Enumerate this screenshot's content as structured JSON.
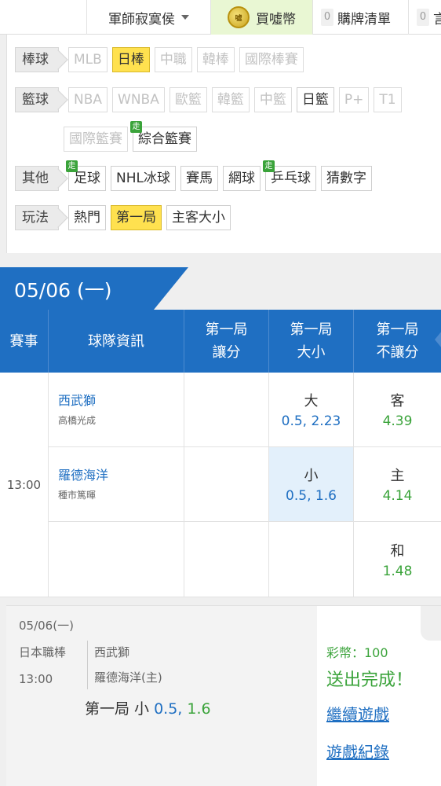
{
  "topbar": {
    "user": "軍師寂寞侯",
    "buy": "買噓幣",
    "coin_icon_text": "噓",
    "cart_count": "0",
    "cart_label": "購牌清單",
    "more_count": "0",
    "more_label": "言"
  },
  "filters": {
    "baseball": {
      "label": "棒球",
      "items": [
        "MLB",
        "日棒",
        "中職",
        "韓棒",
        "國際棒賽"
      ]
    },
    "basketball": {
      "label": "籃球",
      "items": [
        "NBA",
        "WNBA",
        "歐籃",
        "韓籃",
        "中籃",
        "日籃",
        "P+",
        "T1",
        "國際籃賽",
        "綜合籃賽"
      ]
    },
    "other": {
      "label": "其他",
      "items": [
        "足球",
        "NHL冰球",
        "賽馬",
        "網球",
        "乒乓球",
        "猜數字"
      ]
    },
    "play": {
      "label": "玩法",
      "items": [
        "熱門",
        "第一局",
        "主客大小"
      ]
    },
    "zou_badge": "走"
  },
  "date_tab": "05/06 (一)",
  "table": {
    "headers": {
      "event": "賽事",
      "team": "球隊資訊",
      "handicap": [
        "第一局",
        "讓分"
      ],
      "total": [
        "第一局",
        "大小"
      ],
      "moneyline": [
        "第一局",
        "不讓分"
      ]
    },
    "time": "13:00",
    "teams": [
      {
        "name": "西武獅",
        "pitcher": "高橋光成"
      },
      {
        "name": "羅德海洋",
        "pitcher": "種市篤暉"
      }
    ],
    "total": [
      {
        "label": "大",
        "value": "0.5, 2.23"
      },
      {
        "label": "小",
        "value": "0.5, 1.6"
      }
    ],
    "moneyline": [
      {
        "label": "客",
        "value": "4.39"
      },
      {
        "label": "主",
        "value": "4.14"
      },
      {
        "label": "和",
        "value": "1.48"
      }
    ]
  },
  "slip": {
    "date": "05/06(一)",
    "league": "日本職棒",
    "time": "13:00",
    "team1": "西武獅",
    "team2": "羅德海洋(主)",
    "bet_prefix": "第一局 小 ",
    "bet_line": "0.5,",
    "bet_odds": " 1.6",
    "coins": "彩幣：100",
    "done": "送出完成！",
    "continue": "繼續遊戲",
    "history": "遊戲紀錄"
  },
  "colors": {
    "primary_blue": "#1f6fc2",
    "selected_yellow": "#ffe14f",
    "green": "#3aa33a"
  }
}
